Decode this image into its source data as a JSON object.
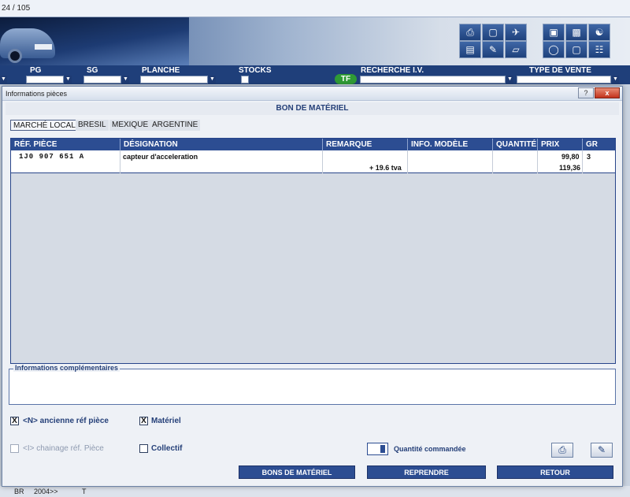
{
  "app": {
    "page_counter": "24 / 105",
    "filters": {
      "pg": "PG",
      "sg": "SG",
      "planche": "PLANCHE",
      "stocks": "STOCKS",
      "recherche": "RECHERCHE I.V.",
      "type_vente": "TYPE DE VENTE"
    },
    "badge": "TF",
    "bottom": {
      "c1": "BR",
      "c2": "2004>>",
      "c3": "T"
    }
  },
  "dialog": {
    "title": "Informations pièces",
    "help": "?",
    "close": "x",
    "section_title": "BON DE MATÉRIEL",
    "tabs": [
      "MARCHÉ LOCAL",
      "BRESIL",
      "MEXIQUE",
      "ARGENTINE"
    ],
    "columns": [
      "RÉF. PIÈCE",
      "DÉSIGNATION",
      "REMARQUE",
      "INFO. MODÈLE",
      "QUANTITÉ",
      "PRIX",
      "GR"
    ],
    "rows": [
      {
        "ref": "1J0 907 651 A",
        "designation": "capteur d'acceleration",
        "remarque": "+ 19.6 tva",
        "info_modele": "",
        "quantite": "",
        "prix": "99,80",
        "prix_ttc": "119,36",
        "gr": "3"
      }
    ],
    "info_legend": "Informations complémentaires",
    "options": {
      "ancienne_ref": {
        "label": "<N> ancienne réf pièce",
        "checked": "X"
      },
      "materiel": {
        "label": "Matériel",
        "checked": "X"
      },
      "chainage": {
        "label": "<I> chainage réf. Pièce"
      },
      "collectif": {
        "label": "Collectif"
      }
    },
    "quantity_label": "Quantité commandée",
    "buttons": {
      "bons": "BONS DE MATÉRIEL",
      "reprendre": "REPRENDRE",
      "retour": "RETOUR"
    }
  }
}
